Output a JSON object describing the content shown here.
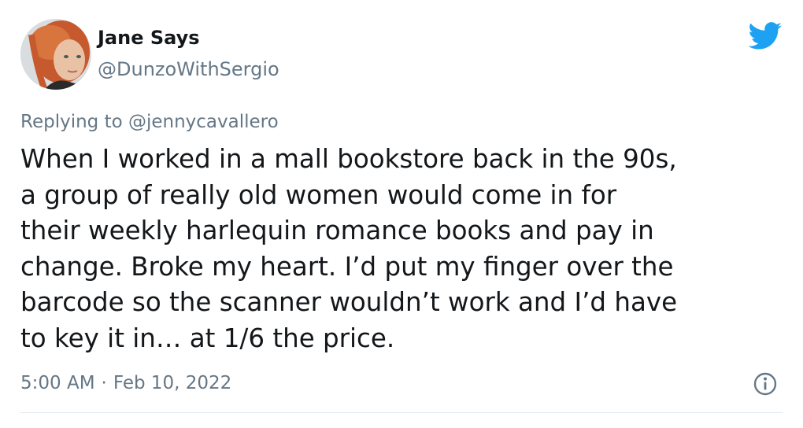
{
  "tweet": {
    "author": {
      "display_name": "Jane Says",
      "handle": "@DunzoWithSergio",
      "avatar_icon": "profile-photo"
    },
    "reply": {
      "prefix": "Replying to ",
      "target": "@jennycavallero"
    },
    "text_lines": [
      "When I worked in a mall bookstore back in the 90s,",
      "a group of really old women would come in for",
      "their weekly harlequin romance books and pay in",
      "change. Broke my heart. I’d put my finger over the",
      "barcode so the scanner wouldn’t work and I’d have",
      "to key it in… at 1/6 the price."
    ],
    "time": "5:00 AM",
    "separator": "·",
    "date": "Feb 10, 2022",
    "icons": {
      "brand": "twitter-bird-icon",
      "info": "info-icon"
    },
    "colors": {
      "brand": "#1DA1F2",
      "text": "#14171a",
      "muted": "#657786",
      "divider": "#e1e8ed"
    }
  }
}
